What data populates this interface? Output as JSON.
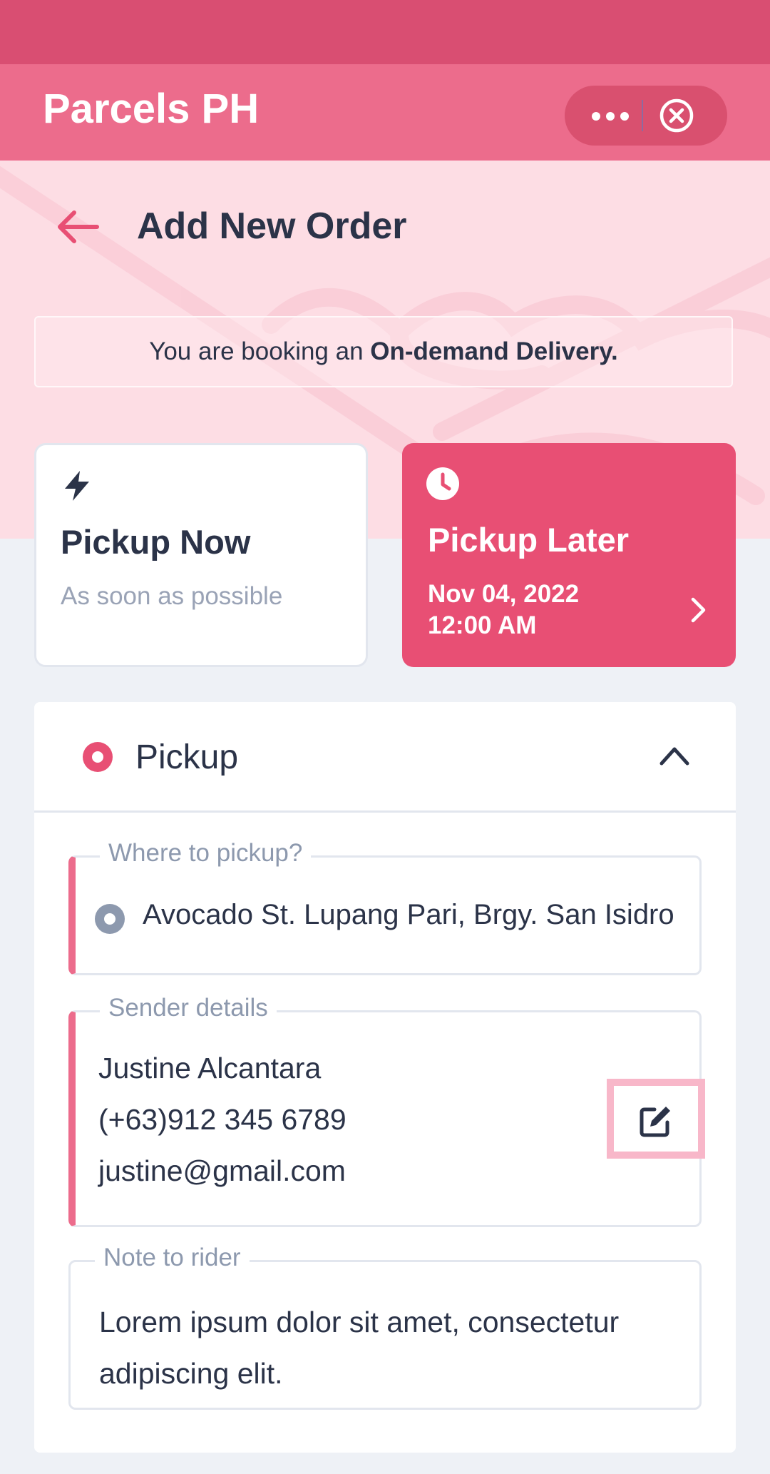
{
  "app": {
    "title": "Parcels PH"
  },
  "capsule": {
    "menu_icon": "more-horizontal-icon",
    "close_icon": "close-circle-icon"
  },
  "header": {
    "title": "Add New Order",
    "back_icon": "arrow-left-icon"
  },
  "notice": {
    "prefix": "You are booking an ",
    "emphasis": "On-demand Delivery."
  },
  "pickup_options": {
    "now": {
      "icon": "lightning-icon",
      "title": "Pickup Now",
      "subtitle": "As soon as possible"
    },
    "later": {
      "icon": "clock-icon",
      "title": "Pickup Later",
      "date": "Nov 04, 2022",
      "time": "12:00 AM",
      "chevron_icon": "chevron-right-icon",
      "selected": true
    }
  },
  "pickup_section": {
    "title": "Pickup",
    "icon": "pickup-marker-icon",
    "expanded": true,
    "location": {
      "legend": "Where to pickup?",
      "value": "Avocado St. Lupang Pari, Brgy. San Isidro"
    },
    "sender": {
      "legend": "Sender details",
      "name": "Justine Alcantara",
      "phone": "(+63)912 345 6789",
      "email": "justine@gmail.com",
      "edit_icon": "edit-icon"
    },
    "note": {
      "legend": "Note to rider",
      "value": "Lorem ipsum dolor sit amet, consectetur adipiscing elit."
    }
  },
  "colors": {
    "primary": "#E84F74",
    "status_bar": "#D94E72",
    "app_bar": "#EC6C8C",
    "hero_bg": "#FDDDE4",
    "text": "#2B3348",
    "muted": "#9AA3B6",
    "page_bg": "#EEF1F6"
  }
}
